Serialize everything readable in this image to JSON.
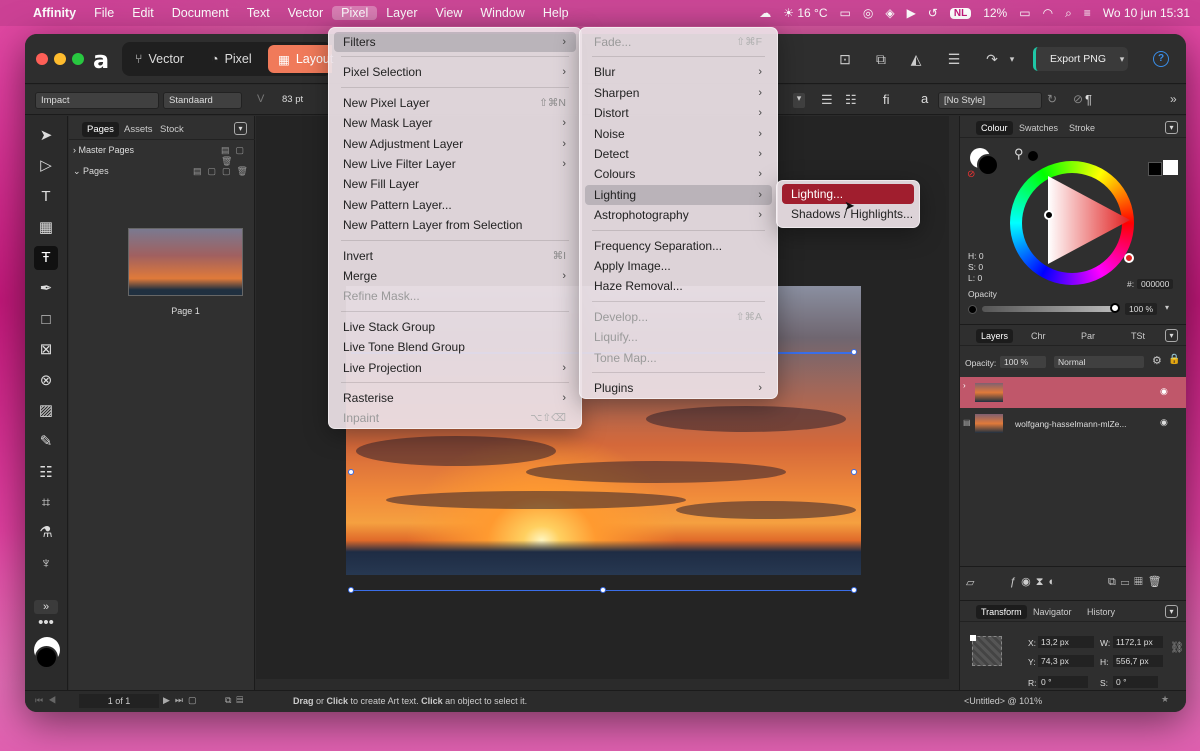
{
  "menubar": {
    "items": [
      "Affinity",
      "File",
      "Edit",
      "Document",
      "Text",
      "Vector",
      "Pixel",
      "Layer",
      "View",
      "Window",
      "Help"
    ],
    "weather": "16 °C",
    "lang": "NL",
    "battery": "12%",
    "datetime": "Wo 10 jun  15:31"
  },
  "toolbar": {
    "personas": [
      "Vector",
      "Pixel",
      "Layout"
    ],
    "export_label": "Export PNG",
    "help": "?"
  },
  "context": {
    "font": "Impact",
    "style": "Standaard",
    "size": "83 pt",
    "char_style": "[No Style]",
    "ligature": "fi",
    "a": "a",
    "pilcrow": "¶"
  },
  "pages_panel": {
    "tabs": [
      "Pages",
      "Assets",
      "Stock"
    ],
    "master": "Master Pages",
    "pages": "Pages",
    "page_label": "Page 1"
  },
  "filters_menu": {
    "col1": [
      {
        "label": "Filters",
        "arrow": true,
        "state": "highlight"
      },
      {
        "sep": true
      },
      {
        "label": "Pixel Selection",
        "arrow": true
      },
      {
        "sep": true
      },
      {
        "label": "New Pixel Layer",
        "shortcut": "⇧⌘N"
      },
      {
        "label": "New Mask Layer",
        "arrow": true
      },
      {
        "label": "New Adjustment Layer",
        "arrow": true
      },
      {
        "label": "New Live Filter Layer",
        "arrow": true
      },
      {
        "label": "New Fill Layer"
      },
      {
        "label": "New Pattern Layer..."
      },
      {
        "label": "New Pattern Layer from Selection"
      },
      {
        "sep": true
      },
      {
        "label": "Invert",
        "shortcut": "⌘I"
      },
      {
        "label": "Merge",
        "arrow": true
      },
      {
        "label": "Refine Mask...",
        "state": "disabled"
      },
      {
        "sep": true
      },
      {
        "label": "Live Stack Group"
      },
      {
        "label": "Live Tone Blend Group"
      },
      {
        "label": "Live Projection",
        "arrow": true
      },
      {
        "sep": true
      },
      {
        "label": "Rasterise",
        "arrow": true
      },
      {
        "label": "Inpaint",
        "shortcut": "⌥⇧⌫",
        "state": "disabled"
      }
    ],
    "col2": [
      {
        "label": "Fade...",
        "shortcut": "⇧⌘F",
        "state": "disabled"
      },
      {
        "sep": true
      },
      {
        "label": "Blur",
        "arrow": true
      },
      {
        "label": "Sharpen",
        "arrow": true
      },
      {
        "label": "Distort",
        "arrow": true
      },
      {
        "label": "Noise",
        "arrow": true
      },
      {
        "label": "Detect",
        "arrow": true
      },
      {
        "label": "Colours",
        "arrow": true
      },
      {
        "label": "Lighting",
        "arrow": true,
        "state": "highlight"
      },
      {
        "label": "Astrophotography",
        "arrow": true
      },
      {
        "sep": true
      },
      {
        "label": "Frequency Separation..."
      },
      {
        "label": "Apply Image..."
      },
      {
        "label": "Haze Removal..."
      },
      {
        "sep": true
      },
      {
        "label": "Develop...",
        "shortcut": "⇧⌘A",
        "state": "disabled"
      },
      {
        "label": "Liquify...",
        "state": "disabled"
      },
      {
        "label": "Tone Map...",
        "state": "disabled"
      },
      {
        "sep": true
      },
      {
        "label": "Plugins",
        "arrow": true
      }
    ],
    "col3": [
      {
        "label": "Lighting...",
        "state": "active"
      },
      {
        "label": "Shadows / Highlights..."
      }
    ]
  },
  "colour_panel": {
    "tabs": [
      "Colour",
      "Swatches",
      "Stroke"
    ],
    "h": "H: 0",
    "s": "S: 0",
    "l": "L: 0",
    "hex_label": "#:",
    "hex": "000000",
    "opacity_label": "Opacity",
    "opacity": "100 %"
  },
  "layers_panel": {
    "tabs": [
      "Layers",
      "Chr",
      "Par",
      "TSt"
    ],
    "opacity_label": "Opacity:",
    "opacity": "100 %",
    "blend": "Normal",
    "layers": [
      {
        "name": "",
        "selected": true
      },
      {
        "name": "wolfgang-hasselmann-mlZe..."
      }
    ]
  },
  "transform_panel": {
    "tabs": [
      "Transform",
      "Navigator",
      "History"
    ],
    "x_label": "X:",
    "x": "13,2 px",
    "w_label": "W:",
    "w": "1172,1 px",
    "y_label": "Y:",
    "y": "74,3 px",
    "h_label": "H:",
    "h": "556,7 px",
    "r_label": "R:",
    "r": "0 °",
    "s_label": "S:",
    "s": "0 °"
  },
  "statusbar": {
    "page_count": "1 of 1",
    "hint_drag": "Drag",
    "hint_or": " or ",
    "hint_click": "Click",
    "hint_mid": " to create Art text. ",
    "hint_click2": "Click",
    "hint_end": " an object to select it.",
    "doc": "<Untitled> @ 101%"
  }
}
